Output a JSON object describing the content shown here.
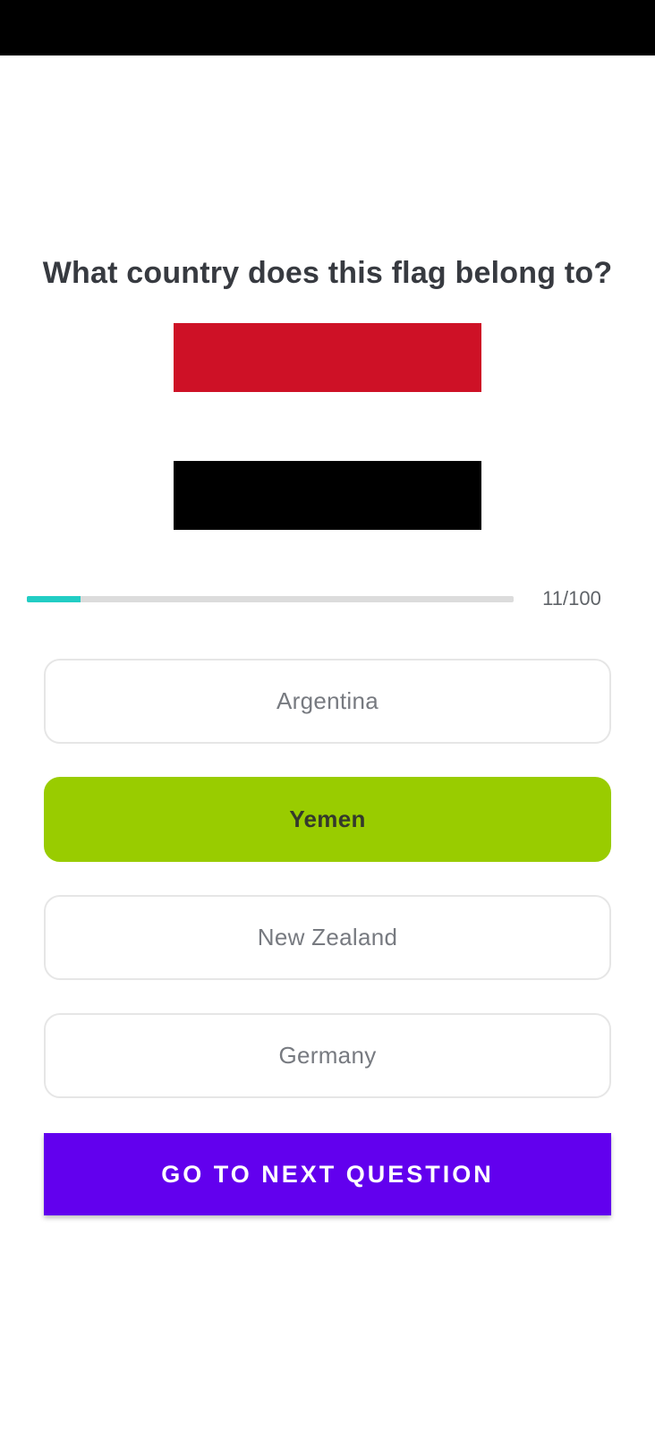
{
  "quiz": {
    "question": "What country does this flag belong to?",
    "flag": {
      "bands": [
        "#ce1126",
        "#ffffff",
        "#000000"
      ]
    },
    "progress": {
      "current": 11,
      "total": 100,
      "label": "11/100",
      "fraction": 0.11,
      "fill_color": "#22cdc4",
      "track_color": "#dcdcdc"
    },
    "answers": [
      {
        "label": "Argentina",
        "selected": false
      },
      {
        "label": "Yemen",
        "selected": true
      },
      {
        "label": "New Zealand",
        "selected": false
      },
      {
        "label": "Germany",
        "selected": false
      }
    ],
    "next_button_label": "GO TO NEXT QUESTION"
  },
  "colors": {
    "correct_answer": "#99cc00",
    "primary_button": "#6200ee"
  }
}
